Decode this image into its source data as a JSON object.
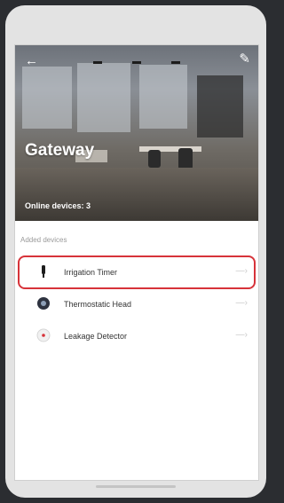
{
  "header": {
    "title": "Gateway",
    "online_label": "Online devices: 3",
    "back_icon": "back-arrow-icon",
    "edit_icon": "edit-pencil-icon"
  },
  "section_title": "Added devices",
  "devices": [
    {
      "label": "Irrigation Timer",
      "icon": "irrigation-timer-icon",
      "highlighted": true
    },
    {
      "label": "Thermostatic Head",
      "icon": "thermostatic-head-icon",
      "highlighted": false
    },
    {
      "label": "Leakage Detector",
      "icon": "leakage-detector-icon",
      "highlighted": false
    }
  ],
  "colors": {
    "highlight": "#d7333a",
    "background": "#2b2d31",
    "device_frame": "#e3e3e3"
  }
}
